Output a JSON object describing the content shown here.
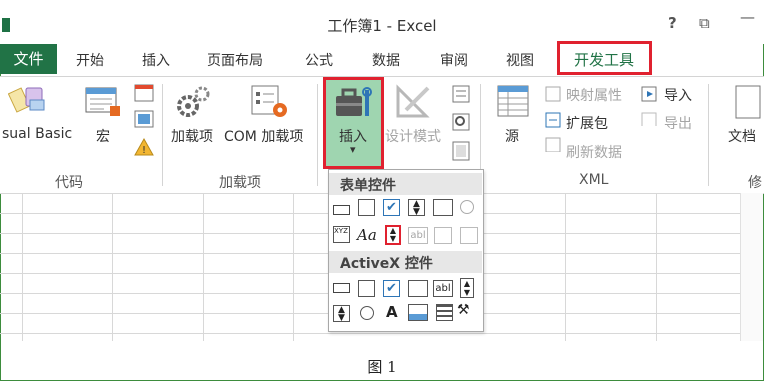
{
  "window": {
    "title": "工作簿1 - Excel",
    "help": "?",
    "restore": "⧉"
  },
  "tabs": [
    "文件",
    "开始",
    "插入",
    "页面布局",
    "公式",
    "数据",
    "审阅",
    "视图",
    "开发工具"
  ],
  "ribbon": {
    "code_group": {
      "visual_basic": "sual Basic",
      "macro": "宏",
      "label": "代码"
    },
    "addins_group": {
      "addins": "加载项",
      "com_addins": "COM 加载项",
      "label": "加载项"
    },
    "controls_group": {
      "insert": "插入",
      "design_mode": "设计模式"
    },
    "xml_group": {
      "source": "源",
      "map_properties": "映射属性",
      "expansion_packs": "扩展包",
      "refresh_data": "刷新数据",
      "import": "导入",
      "export": "导出",
      "label": "XML"
    },
    "document_group": {
      "document": "文档",
      "label": "修"
    }
  },
  "dropdown": {
    "form_controls_title": "表单控件",
    "activex_title": "ActiveX 控件",
    "xyz": "XYZ",
    "aa": "Aa",
    "abl": "abl",
    "a_label": "A"
  },
  "colors": {
    "excel_green": "#217346",
    "highlight_red": "#e0212f",
    "insert_bg": "#9fd5b0"
  },
  "caption": "图 1"
}
